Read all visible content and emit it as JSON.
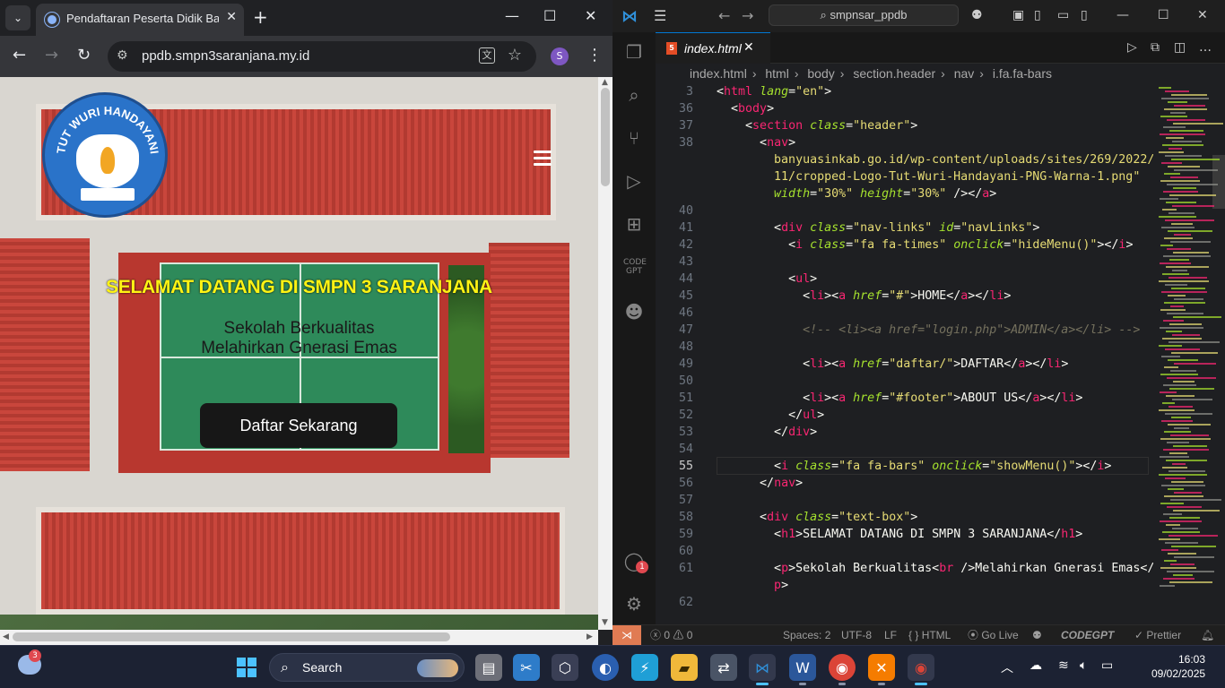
{
  "browser": {
    "tab_title": "Pendaftaran Peserta Didik Baru",
    "url": "ppdb.smpn3saranjana.my.id",
    "profile_initial": "S",
    "page": {
      "logo_text": "TUT WURI HANDAYANI",
      "heading": "SELAMAT DATANG DI SMPN 3 SARANJANA",
      "subtitle_line1": "Sekolah Berkualitas",
      "subtitle_line2": "Melahirkan Gnerasi Emas",
      "cta_label": "Daftar Sekarang"
    }
  },
  "vscode": {
    "search_text": "smpnsar_ppdb",
    "tab_name": "index.html",
    "breadcrumb": [
      "index.html",
      "html",
      "body",
      "section.header",
      "nav",
      "i.fa.fa-bars"
    ],
    "lines": [
      {
        "n": "3",
        "html": "<span class='t-txt'>&lt;</span><span class='t-tag'>html</span> <span class='t-attr'>lang</span><span class='t-txt'>=</span><span class='t-str'>\"en\"</span><span class='t-txt'>&gt;</span>"
      },
      {
        "n": "36",
        "html": "  <span class='t-txt'>&lt;</span><span class='t-tag'>body</span><span class='t-txt'>&gt;</span>"
      },
      {
        "n": "37",
        "html": "    <span class='t-txt'>&lt;</span><span class='t-tag'>section</span> <span class='t-attr'>class</span><span class='t-txt'>=</span><span class='t-str'>\"header\"</span><span class='t-txt'>&gt;</span>"
      },
      {
        "n": "38",
        "html": "      <span class='t-txt'>&lt;</span><span class='t-tag'>nav</span><span class='t-txt'>&gt;</span>"
      },
      {
        "n": "",
        "html": "        <span class='t-str'>banyuasinkab.go.id/wp-content/uploads/sites/269/2022/</span>"
      },
      {
        "n": "",
        "html": "        <span class='t-str'>11/cropped-Logo-Tut-Wuri-Handayani-PNG-Warna-1.png\"</span>"
      },
      {
        "n": "",
        "html": "        <span class='t-attr'>width</span><span class='t-txt'>=</span><span class='t-str'>\"30%\"</span> <span class='t-attr'>height</span><span class='t-txt'>=</span><span class='t-str'>\"30%\"</span> <span class='t-txt'>/&gt;&lt;/</span><span class='t-tag'>a</span><span class='t-txt'>&gt;</span>"
      },
      {
        "n": "40",
        "html": ""
      },
      {
        "n": "41",
        "html": "        <span class='t-txt'>&lt;</span><span class='t-tag'>div</span> <span class='t-attr'>class</span><span class='t-txt'>=</span><span class='t-str'>\"nav-links\"</span> <span class='t-attr'>id</span><span class='t-txt'>=</span><span class='t-str'>\"navLinks\"</span><span class='t-txt'>&gt;</span>"
      },
      {
        "n": "42",
        "html": "          <span class='t-txt'>&lt;</span><span class='t-tag'>i</span> <span class='t-attr'>class</span><span class='t-txt'>=</span><span class='t-str'>\"fa fa-times\"</span> <span class='t-attr'>onclick</span><span class='t-txt'>=</span><span class='t-str'>\"hideMenu()\"</span><span class='t-txt'>&gt;&lt;/</span><span class='t-tag'>i</span><span class='t-txt'>&gt;</span>"
      },
      {
        "n": "43",
        "html": ""
      },
      {
        "n": "44",
        "html": "          <span class='t-txt'>&lt;</span><span class='t-tag'>ul</span><span class='t-txt'>&gt;</span>"
      },
      {
        "n": "45",
        "html": "            <span class='t-txt'>&lt;</span><span class='t-tag'>li</span><span class='t-txt'>&gt;&lt;</span><span class='t-tag'>a</span> <span class='t-attr'>href</span><span class='t-txt'>=</span><span class='t-str'>\"#\"</span><span class='t-txt'>&gt;HOME&lt;/</span><span class='t-tag'>a</span><span class='t-txt'>&gt;&lt;/</span><span class='t-tag'>li</span><span class='t-txt'>&gt;</span>"
      },
      {
        "n": "46",
        "html": ""
      },
      {
        "n": "47",
        "html": "            <span class='t-cm'>&lt;!-- &lt;li&gt;&lt;a href=\"login.php\"&gt;ADMIN&lt;/a&gt;&lt;/li&gt; --&gt;</span>"
      },
      {
        "n": "48",
        "html": ""
      },
      {
        "n": "49",
        "html": "            <span class='t-txt'>&lt;</span><span class='t-tag'>li</span><span class='t-txt'>&gt;&lt;</span><span class='t-tag'>a</span> <span class='t-attr'>href</span><span class='t-txt'>=</span><span class='t-str'>\"daftar/\"</span><span class='t-txt'>&gt;DAFTAR&lt;/</span><span class='t-tag'>a</span><span class='t-txt'>&gt;&lt;/</span><span class='t-tag'>li</span><span class='t-txt'>&gt;</span>"
      },
      {
        "n": "50",
        "html": ""
      },
      {
        "n": "51",
        "html": "            <span class='t-txt'>&lt;</span><span class='t-tag'>li</span><span class='t-txt'>&gt;&lt;</span><span class='t-tag'>a</span> <span class='t-attr'>href</span><span class='t-txt'>=</span><span class='t-str'>\"#footer\"</span><span class='t-txt'>&gt;ABOUT US&lt;/</span><span class='t-tag'>a</span><span class='t-txt'>&gt;&lt;/</span><span class='t-tag'>li</span><span class='t-txt'>&gt;</span>"
      },
      {
        "n": "52",
        "html": "          <span class='t-txt'>&lt;/</span><span class='t-tag'>ul</span><span class='t-txt'>&gt;</span>"
      },
      {
        "n": "53",
        "html": "        <span class='t-txt'>&lt;/</span><span class='t-tag'>div</span><span class='t-txt'>&gt;</span>"
      },
      {
        "n": "54",
        "html": ""
      },
      {
        "n": "55",
        "html": "        <span class='t-txt'>&lt;</span><span class='t-tag'>i</span> <span class='t-attr'>class</span><span class='t-txt'>=</span><span class='t-str'>\"fa fa-bars\"</span> <span class='t-attr'>onclick</span><span class='t-txt'>=</span><span class='t-str'>\"showMenu()\"</span><span class='t-txt'>&gt;&lt;/</span><span class='t-tag'>i</span><span class='t-txt'>&gt;</span>"
      },
      {
        "n": "56",
        "html": "      <span class='t-txt'>&lt;/</span><span class='t-tag'>nav</span><span class='t-txt'>&gt;</span>"
      },
      {
        "n": "57",
        "html": ""
      },
      {
        "n": "58",
        "html": "      <span class='t-txt'>&lt;</span><span class='t-tag'>div</span> <span class='t-attr'>class</span><span class='t-txt'>=</span><span class='t-str'>\"text-box\"</span><span class='t-txt'>&gt;</span>"
      },
      {
        "n": "59",
        "html": "        <span class='t-txt'>&lt;</span><span class='t-tag'>h1</span><span class='t-txt'>&gt;SELAMAT DATANG DI SMPN 3 SARANJANA&lt;/</span><span class='t-tag'>h1</span><span class='t-txt'>&gt;</span>"
      },
      {
        "n": "60",
        "html": ""
      },
      {
        "n": "61",
        "html": "        <span class='t-txt'>&lt;</span><span class='t-tag'>p</span><span class='t-txt'>&gt;Sekolah Berkualitas&lt;</span><span class='t-tag'>br</span> <span class='t-txt'>/&gt;Melahirkan Gnerasi Emas&lt;/</span>"
      },
      {
        "n": "",
        "html": "        <span class='t-tag'>p</span><span class='t-txt'>&gt;</span>"
      },
      {
        "n": "62",
        "html": ""
      }
    ],
    "active_line": "55",
    "status": {
      "errors": "0",
      "warnings": "0",
      "spaces": "Spaces: 2",
      "encoding": "UTF-8",
      "eol": "LF",
      "language": "HTML",
      "golive": "Go Live",
      "codegpt": "CODEGPT",
      "prettier": "Prettier"
    },
    "activity_badge": "1"
  },
  "taskbar": {
    "weather_badge": "3",
    "search_label": "Search",
    "time": "16:03",
    "date": "09/02/2025"
  },
  "colors": {
    "hero_title": "#fff314",
    "cta_bg": "#171717",
    "vs_tag": "#f92672",
    "vs_attr": "#a6e22e",
    "vs_string": "#e6db74",
    "windows_accent": "#4cc2ff"
  }
}
